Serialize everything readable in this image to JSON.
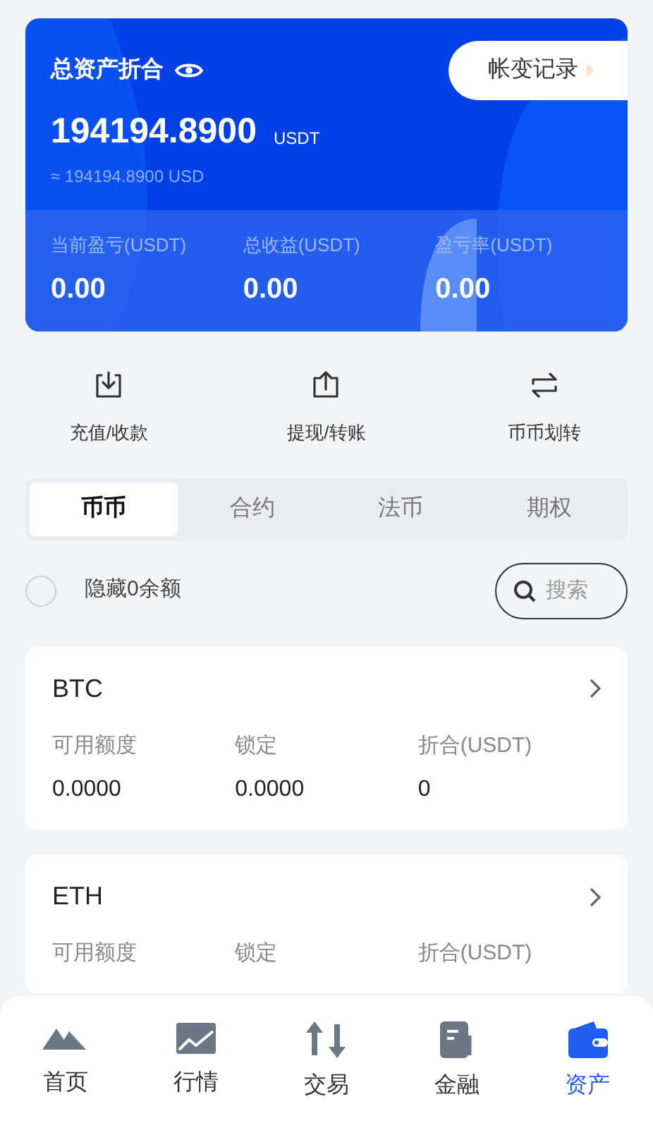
{
  "summary": {
    "title": "总资产折合",
    "record_button": "帐变记录",
    "total": "194194.8900",
    "unit": "USDT",
    "approx": "≈ 194194.8900 USD",
    "stats": [
      {
        "label": "当前盈亏(USDT)",
        "value": "0.00"
      },
      {
        "label": "总收益(USDT)",
        "value": "0.00"
      },
      {
        "label": "盈亏率(USDT)",
        "value": "0.00"
      }
    ]
  },
  "actions": [
    {
      "kind": "deposit",
      "label": "充值/收款"
    },
    {
      "kind": "withdraw",
      "label": "提现/转账"
    },
    {
      "kind": "transfer",
      "label": "币币划转"
    }
  ],
  "tabs": [
    {
      "label": "币币",
      "selected": true
    },
    {
      "label": "合约",
      "selected": false
    },
    {
      "label": "法币",
      "selected": false
    },
    {
      "label": "期权",
      "selected": false
    }
  ],
  "hide_zero": {
    "label": "隐藏0余额",
    "checked": false
  },
  "search": {
    "placeholder": "搜索"
  },
  "coins": [
    {
      "name": "BTC",
      "columns": [
        {
          "label": "可用额度",
          "value": "0.0000"
        },
        {
          "label": "锁定",
          "value": "0.0000"
        },
        {
          "label": "折合(USDT)",
          "value": "0"
        }
      ]
    },
    {
      "name": "ETH",
      "columns": [
        {
          "label": "可用额度"
        },
        {
          "label": "锁定"
        },
        {
          "label": "折合(USDT)"
        }
      ]
    }
  ],
  "nav": [
    {
      "kind": "home",
      "label": "首页",
      "selected": false
    },
    {
      "kind": "market",
      "label": "行情",
      "selected": false
    },
    {
      "kind": "trade",
      "label": "交易",
      "selected": false
    },
    {
      "kind": "finance",
      "label": "金融",
      "selected": false
    },
    {
      "kind": "assets",
      "label": "资产",
      "selected": true
    }
  ]
}
